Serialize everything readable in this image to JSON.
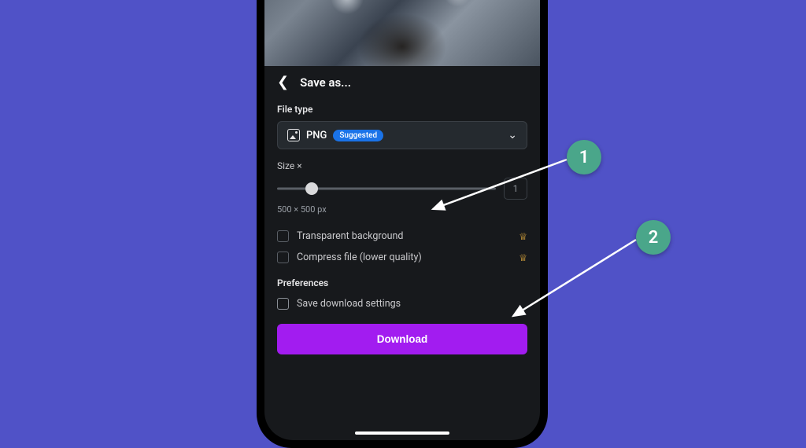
{
  "header": {
    "title": "Save as..."
  },
  "filetype": {
    "section_label": "File type",
    "value": "PNG",
    "suggested_badge": "Suggested"
  },
  "size": {
    "label": "Size ×",
    "value": "1",
    "dimensions": "500 × 500 px"
  },
  "options": {
    "transparent_bg": "Transparent background",
    "compress": "Compress file (lower quality)"
  },
  "preferences": {
    "section_label": "Preferences",
    "save_settings": "Save download settings"
  },
  "actions": {
    "download": "Download"
  },
  "annotations": {
    "step1": "1",
    "step2": "2"
  }
}
